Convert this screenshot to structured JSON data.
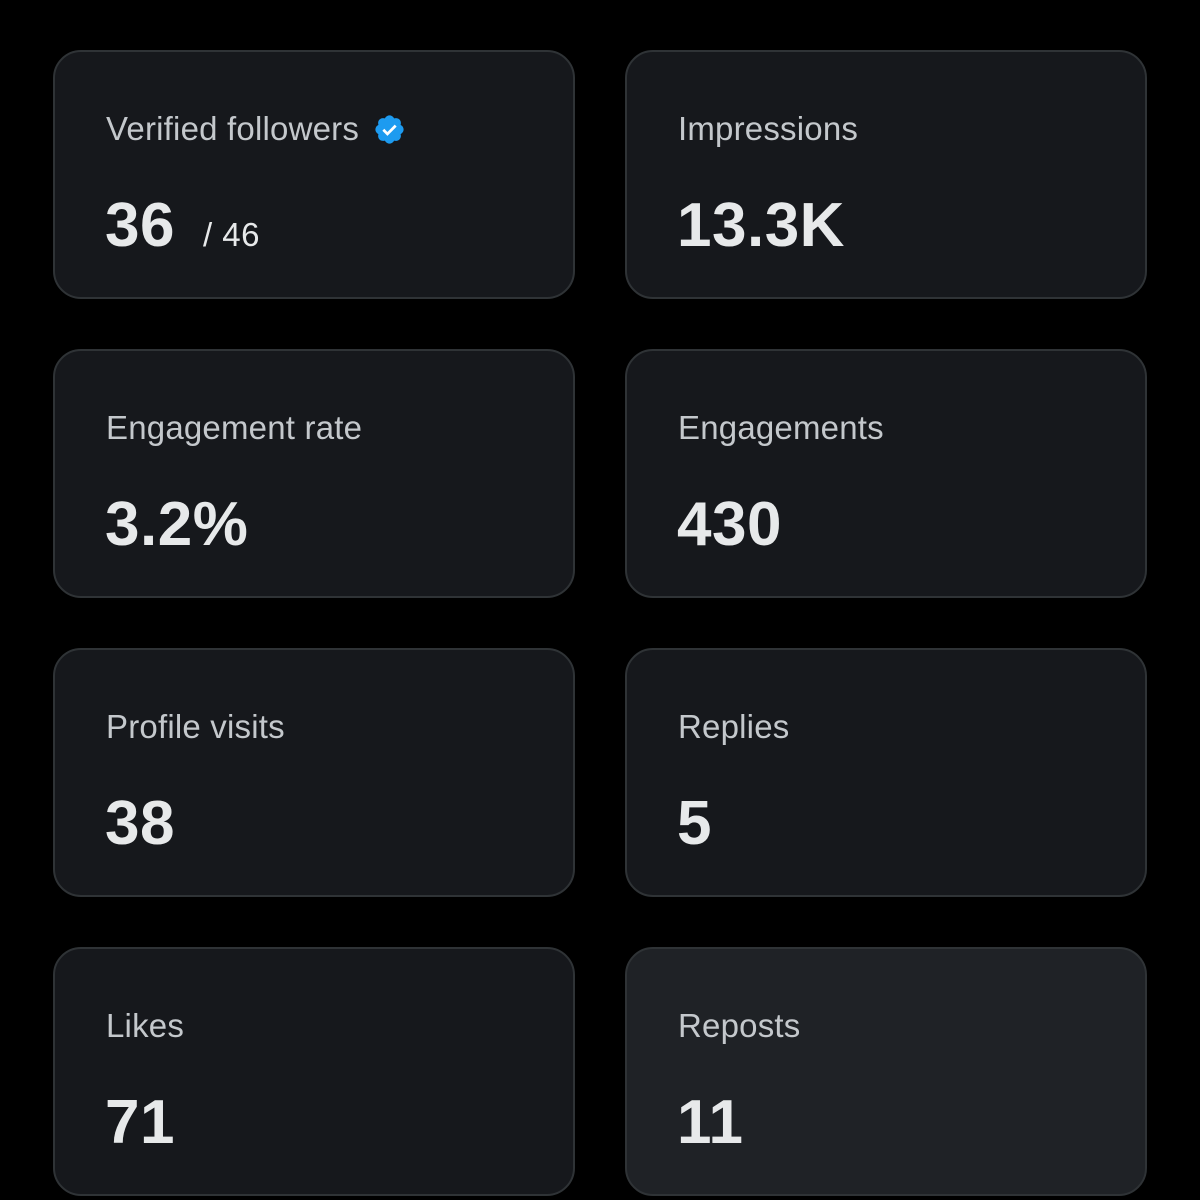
{
  "colors": {
    "background": "#000000",
    "card": "#16181c",
    "card_highlight": "#1f2226",
    "border": "#2f3336",
    "label": "#c4c8cc",
    "value": "#e7e9ea",
    "verified_badge": "#1d9bf0"
  },
  "metrics": [
    {
      "label": "Verified followers",
      "value": "36",
      "sub": "/ 46",
      "icon": "verified-badge-icon"
    },
    {
      "label": "Impressions",
      "value": "13.3K"
    },
    {
      "label": "Engagement rate",
      "value": "3.2%"
    },
    {
      "label": "Engagements",
      "value": "430"
    },
    {
      "label": "Profile visits",
      "value": "38"
    },
    {
      "label": "Replies",
      "value": "5"
    },
    {
      "label": "Likes",
      "value": "71"
    },
    {
      "label": "Reposts",
      "value": "11",
      "highlighted": true
    }
  ]
}
